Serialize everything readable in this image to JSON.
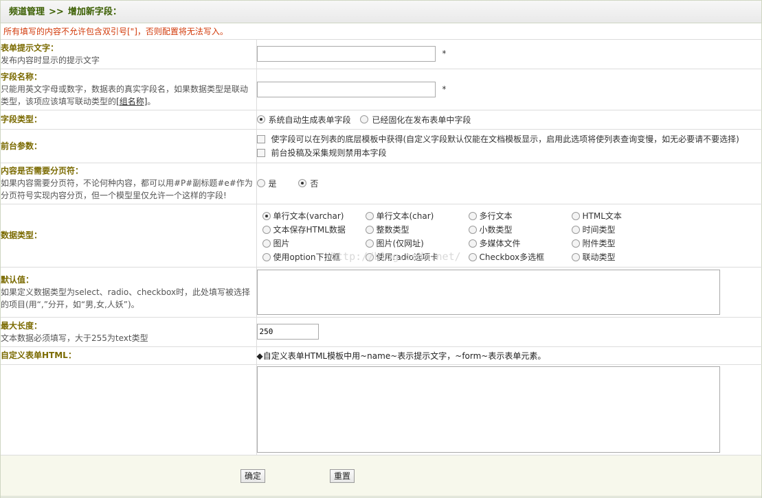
{
  "breadcrumb": {
    "section": "频道管理",
    "separator": ">>",
    "current": "增加新字段："
  },
  "warning": "所有填写的内容不允许包含双引号[\"]，否则配置将无法写入。",
  "form": {
    "itemname": {
      "label": "表单提示文字：",
      "desc": "发布内容时显示的提示文字",
      "value": "",
      "required": "*"
    },
    "fieldname": {
      "label": "字段名称：",
      "desc": "只能用英文字母或数字，数据表的真实字段名，如果数据类型是联动类型，该项应该填写联动类型的",
      "link": "[组名称]",
      "desc_end": "。",
      "value": "",
      "required": "*"
    },
    "isnull": {
      "label": "字段类型：",
      "options": [
        "系统自动生成表单字段",
        "已经固化在发布表单中字段"
      ],
      "selected": 0
    },
    "front": {
      "label": "前台参数：",
      "checks": [
        "使字段可以在列表的底层模板中获得(自定义字段默认仅能在文档模板显示，启用此选项将使列表查询变慢，如无必要请不要选择)",
        "前台投稿及采集规则禁用本字段"
      ]
    },
    "paging": {
      "label": "内容是否需要分页符：",
      "desc": "如果内容需要分页符，不论何种内容，都可以用#P#副标题#e#作为分页符号实现内容分页，但一个模型里仅允许一个这样的字段!",
      "options": [
        "是",
        "否"
      ],
      "selected": 1
    },
    "dtype": {
      "label": "数据类型：",
      "options": [
        "单行文本(varchar)",
        "单行文本(char)",
        "多行文本",
        "HTML文本",
        "文本保存HTML数据",
        "整数类型",
        "小数类型",
        "时间类型",
        "图片",
        "图片(仅网址)",
        "多媒体文件",
        "附件类型",
        "使用option下拉框",
        "使用radio选项卡",
        "Checkbox多选框",
        "联动类型"
      ],
      "selected": 0
    },
    "default": {
      "label": "默认值：",
      "desc": "如果定义数据类型为select、radio、checkbox时，此处填写被选择的项目(用“,”分开，如“男,女,人妖”)。",
      "value": ""
    },
    "maxlength": {
      "label": "最大长度：",
      "desc": "文本数据必须填写，大于255为text类型",
      "value": "250"
    },
    "custom_html": {
      "label": "自定义表单HTML：",
      "note": "◆自定义表单HTML模板中用~name~表示提示文字，~form~表示表单元素。",
      "value": ""
    }
  },
  "buttons": {
    "submit": "确定",
    "reset": "重置"
  },
  "watermark": "http://blog.csdn.net/"
}
